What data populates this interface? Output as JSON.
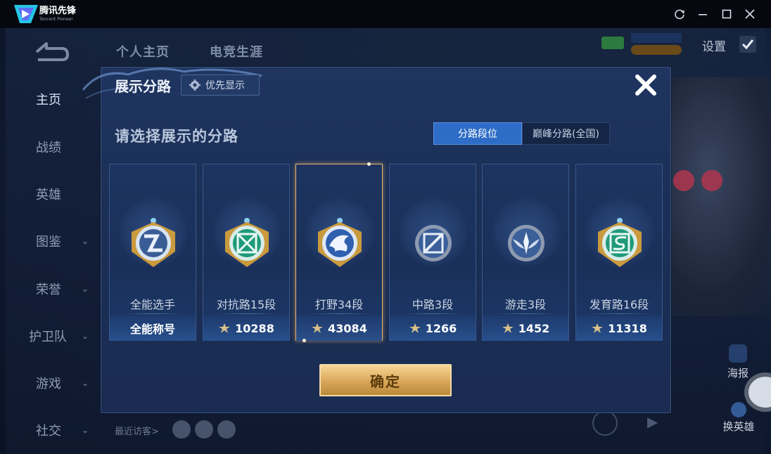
{
  "window": {
    "app_name": "腾讯先锋",
    "app_sub": "Tencent Pioneer",
    "controls": [
      "refresh-icon",
      "minimize-icon",
      "maximize-icon",
      "close-icon"
    ]
  },
  "top_tabs": [
    "个人主页",
    "电竞生涯"
  ],
  "sidebar": {
    "items": [
      {
        "label": "主页",
        "active": true,
        "chevron": false
      },
      {
        "label": "战绩",
        "active": false,
        "chevron": false
      },
      {
        "label": "英雄",
        "active": false,
        "chevron": false
      },
      {
        "label": "图鉴",
        "active": false,
        "chevron": true
      },
      {
        "label": "荣誉",
        "active": false,
        "chevron": true
      },
      {
        "label": "护卫队",
        "active": false,
        "chevron": true
      },
      {
        "label": "游戏",
        "active": false,
        "chevron": true
      },
      {
        "label": "社交",
        "active": false,
        "chevron": true
      }
    ]
  },
  "header_right": {
    "settings_label": "设置"
  },
  "background": {
    "recent_visitors_label": "最近访客>",
    "poster_label": "海报",
    "change_hero_label": "换英雄"
  },
  "modal": {
    "title": "展示分路",
    "priority_button": "优先显示",
    "subtitle": "请选择展示的分路",
    "segments": [
      {
        "label": "分路段位",
        "active": true
      },
      {
        "label": "巅峰分路(全国)",
        "active": false
      }
    ],
    "cards": [
      {
        "name": "全能选手",
        "footer": "全能称号",
        "has_points": false,
        "selected": false,
        "emblem": "allround-emblem-icon",
        "ring": "#c99a3e",
        "core": "#3b5d96"
      },
      {
        "name": "对抗路15段",
        "footer": "10288",
        "has_points": true,
        "selected": false,
        "emblem": "clash-lane-emblem-icon",
        "ring": "#c99a3e",
        "core": "#1f9a7a"
      },
      {
        "name": "打野34段",
        "footer": "43084",
        "has_points": true,
        "selected": true,
        "emblem": "jungle-emblem-icon",
        "ring": "#c99a3e",
        "core": "#2f5fae"
      },
      {
        "name": "中路3段",
        "footer": "1266",
        "has_points": true,
        "selected": false,
        "emblem": "mid-lane-emblem-icon",
        "ring": "#8e9ab0",
        "core": "#3a5f99"
      },
      {
        "name": "游走3段",
        "footer": "1452",
        "has_points": true,
        "selected": false,
        "emblem": "roam-emblem-icon",
        "ring": "#8e9ab0",
        "core": "#3a5f99"
      },
      {
        "name": "发育路16段",
        "footer": "11318",
        "has_points": true,
        "selected": false,
        "emblem": "farm-lane-emblem-icon",
        "ring": "#c99a3e",
        "core": "#1f9a7a"
      }
    ],
    "confirm_button": "确定"
  },
  "colors": {
    "accent_blue": "#2e6dc7",
    "gold": "#d9a659",
    "selected_border": "#e8b36a"
  }
}
